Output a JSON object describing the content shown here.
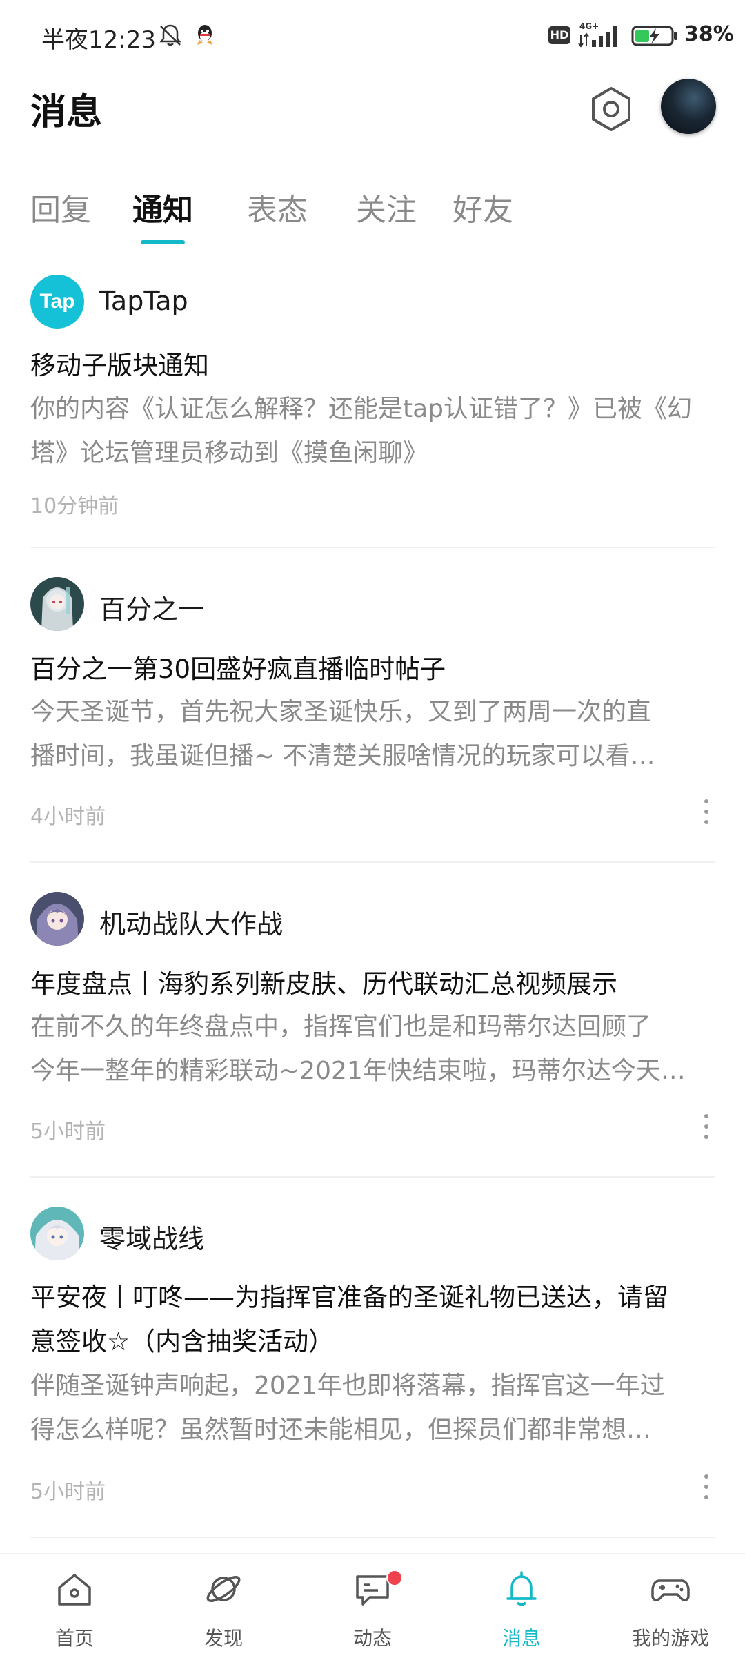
{
  "status_bar": {
    "time": "半夜12:23",
    "network": "4G+",
    "hd_label": "HD",
    "battery": "38%"
  },
  "header": {
    "title": "消息"
  },
  "tabs": [
    {
      "label": "回复",
      "active": false
    },
    {
      "label": "通知",
      "active": true
    },
    {
      "label": "表态",
      "active": false
    },
    {
      "label": "关注",
      "active": false
    },
    {
      "label": "好友",
      "active": false
    }
  ],
  "notifications": [
    {
      "sender": "TapTap",
      "avatar_text": "Tap",
      "title": "移动子版块通知",
      "body_lines": [
        "你的内容《认证怎么解释？还能是tap认证错了？》已被《幻",
        "塔》论坛管理员移动到《摸鱼闲聊》"
      ],
      "time": "10分钟前",
      "has_more": false
    },
    {
      "sender": "百分之一",
      "title": "百分之一第30回盛好疯直播临时帖子",
      "body_lines": [
        "今天圣诞节，首先祝大家圣诞快乐，又到了两周一次的直",
        "播时间，我虽诞但播~ 不清楚关服啥情况的玩家可以看…"
      ],
      "time": "4小时前",
      "has_more": true
    },
    {
      "sender": "机动战队大作战",
      "title": "年度盘点丨海豹系列新皮肤、历代联动汇总视频展示",
      "body_lines": [
        "在前不久的年终盘点中，指挥官们也是和玛蒂尔达回顾了",
        "今年一整年的精彩联动~2021年快结束啦，玛蒂尔达今天…"
      ],
      "time": "5小时前",
      "has_more": true
    },
    {
      "sender": "零域战线",
      "title_lines": [
        "平安夜丨叮咚——为指挥官准备的圣诞礼物已送达，请留",
        "意签收☆（内含抽奖活动）"
      ],
      "body_lines": [
        "伴随圣诞钟声响起，2021年也即将落幕，指挥官这一年过",
        "得怎么样呢？虽然暂时还未能相见，但探员们都非常想…"
      ],
      "time": "5小时前",
      "has_more": true
    }
  ],
  "bottom_nav": [
    {
      "label": "首页",
      "icon": "home-icon",
      "active": false
    },
    {
      "label": "发现",
      "icon": "planet-icon",
      "active": false
    },
    {
      "label": "动态",
      "icon": "chat-icon",
      "active": false,
      "badge": true
    },
    {
      "label": "消息",
      "icon": "bell-icon",
      "active": true
    },
    {
      "label": "我的游戏",
      "icon": "gamepad-icon",
      "active": false
    }
  ],
  "colors": {
    "accent": "#14b9c8",
    "badge": "#f0424e",
    "taptap_brand": "#14c1d6"
  }
}
